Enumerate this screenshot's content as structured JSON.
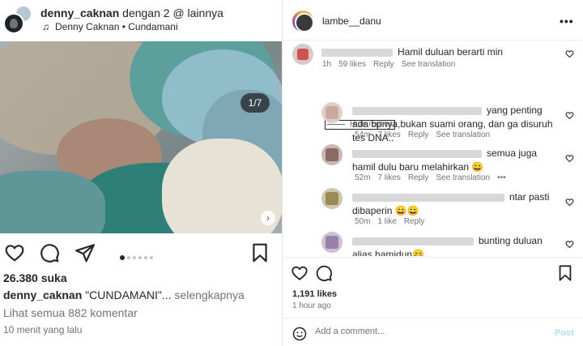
{
  "post": {
    "header": {
      "username": "denny_caknan",
      "with_text": "dengan 2 @ lainnya",
      "audio": "Denny Caknan • Cundamani"
    },
    "media": {
      "counter": "1/7",
      "next_icon": "chevron-right-icon",
      "mute_icon": "speaker-muted-icon",
      "dots_total": 6,
      "dots_active": 0
    },
    "actions": {
      "like_icon": "heart-icon",
      "comment_icon": "comment-icon",
      "share_icon": "paper-plane-icon",
      "save_icon": "bookmark-icon"
    },
    "likes": "26.380 suka",
    "caption": {
      "username": "denny_caknan",
      "text": "\"CUNDAMANI\"...",
      "more": "selengkapnya"
    },
    "view_comments": "Lihat semua 882 komentar",
    "time_ago": "10 menit yang lalu"
  },
  "sidebar": {
    "header": {
      "username": "lambe__danu",
      "more_icon": "more-horizontal-icon"
    },
    "comments": [
      {
        "text": "Hamil duluan berarti min",
        "meta": [
          "1h",
          "59 likes",
          "Reply",
          "See translation"
        ],
        "avatar_color": "#d05058"
      }
    ],
    "hide_replies": "Hide replies",
    "replies": [
      {
        "text": "yang penting ada bpnya,bukan suami orang, dan ga disuruh tes DNA..",
        "meta": [
          "54m",
          "7 likes",
          "Reply",
          "See translation"
        ],
        "avatar_color": "#c9a9a0"
      },
      {
        "text": "semua juga hamil dulu baru melahirkan 😄",
        "meta": [
          "52m",
          "7 likes",
          "Reply",
          "See translation",
          "•••"
        ],
        "avatar_color": "#8b6a63"
      },
      {
        "text": "ntar pasti dibaperin 😄😄",
        "meta": [
          "50m",
          "1 like",
          "Reply"
        ],
        "avatar_color": "#9a8a58"
      },
      {
        "text": "bunting duluan alias hamidun😄",
        "meta": [],
        "avatar_color": "#9a7fa8"
      }
    ],
    "likes": "1,191 likes",
    "time": "1 hour ago",
    "add_comment_placeholder": "Add a comment...",
    "post_label": "Post",
    "colors": {
      "post_button": "#b3dbff",
      "secondary_text": "#737373"
    }
  }
}
